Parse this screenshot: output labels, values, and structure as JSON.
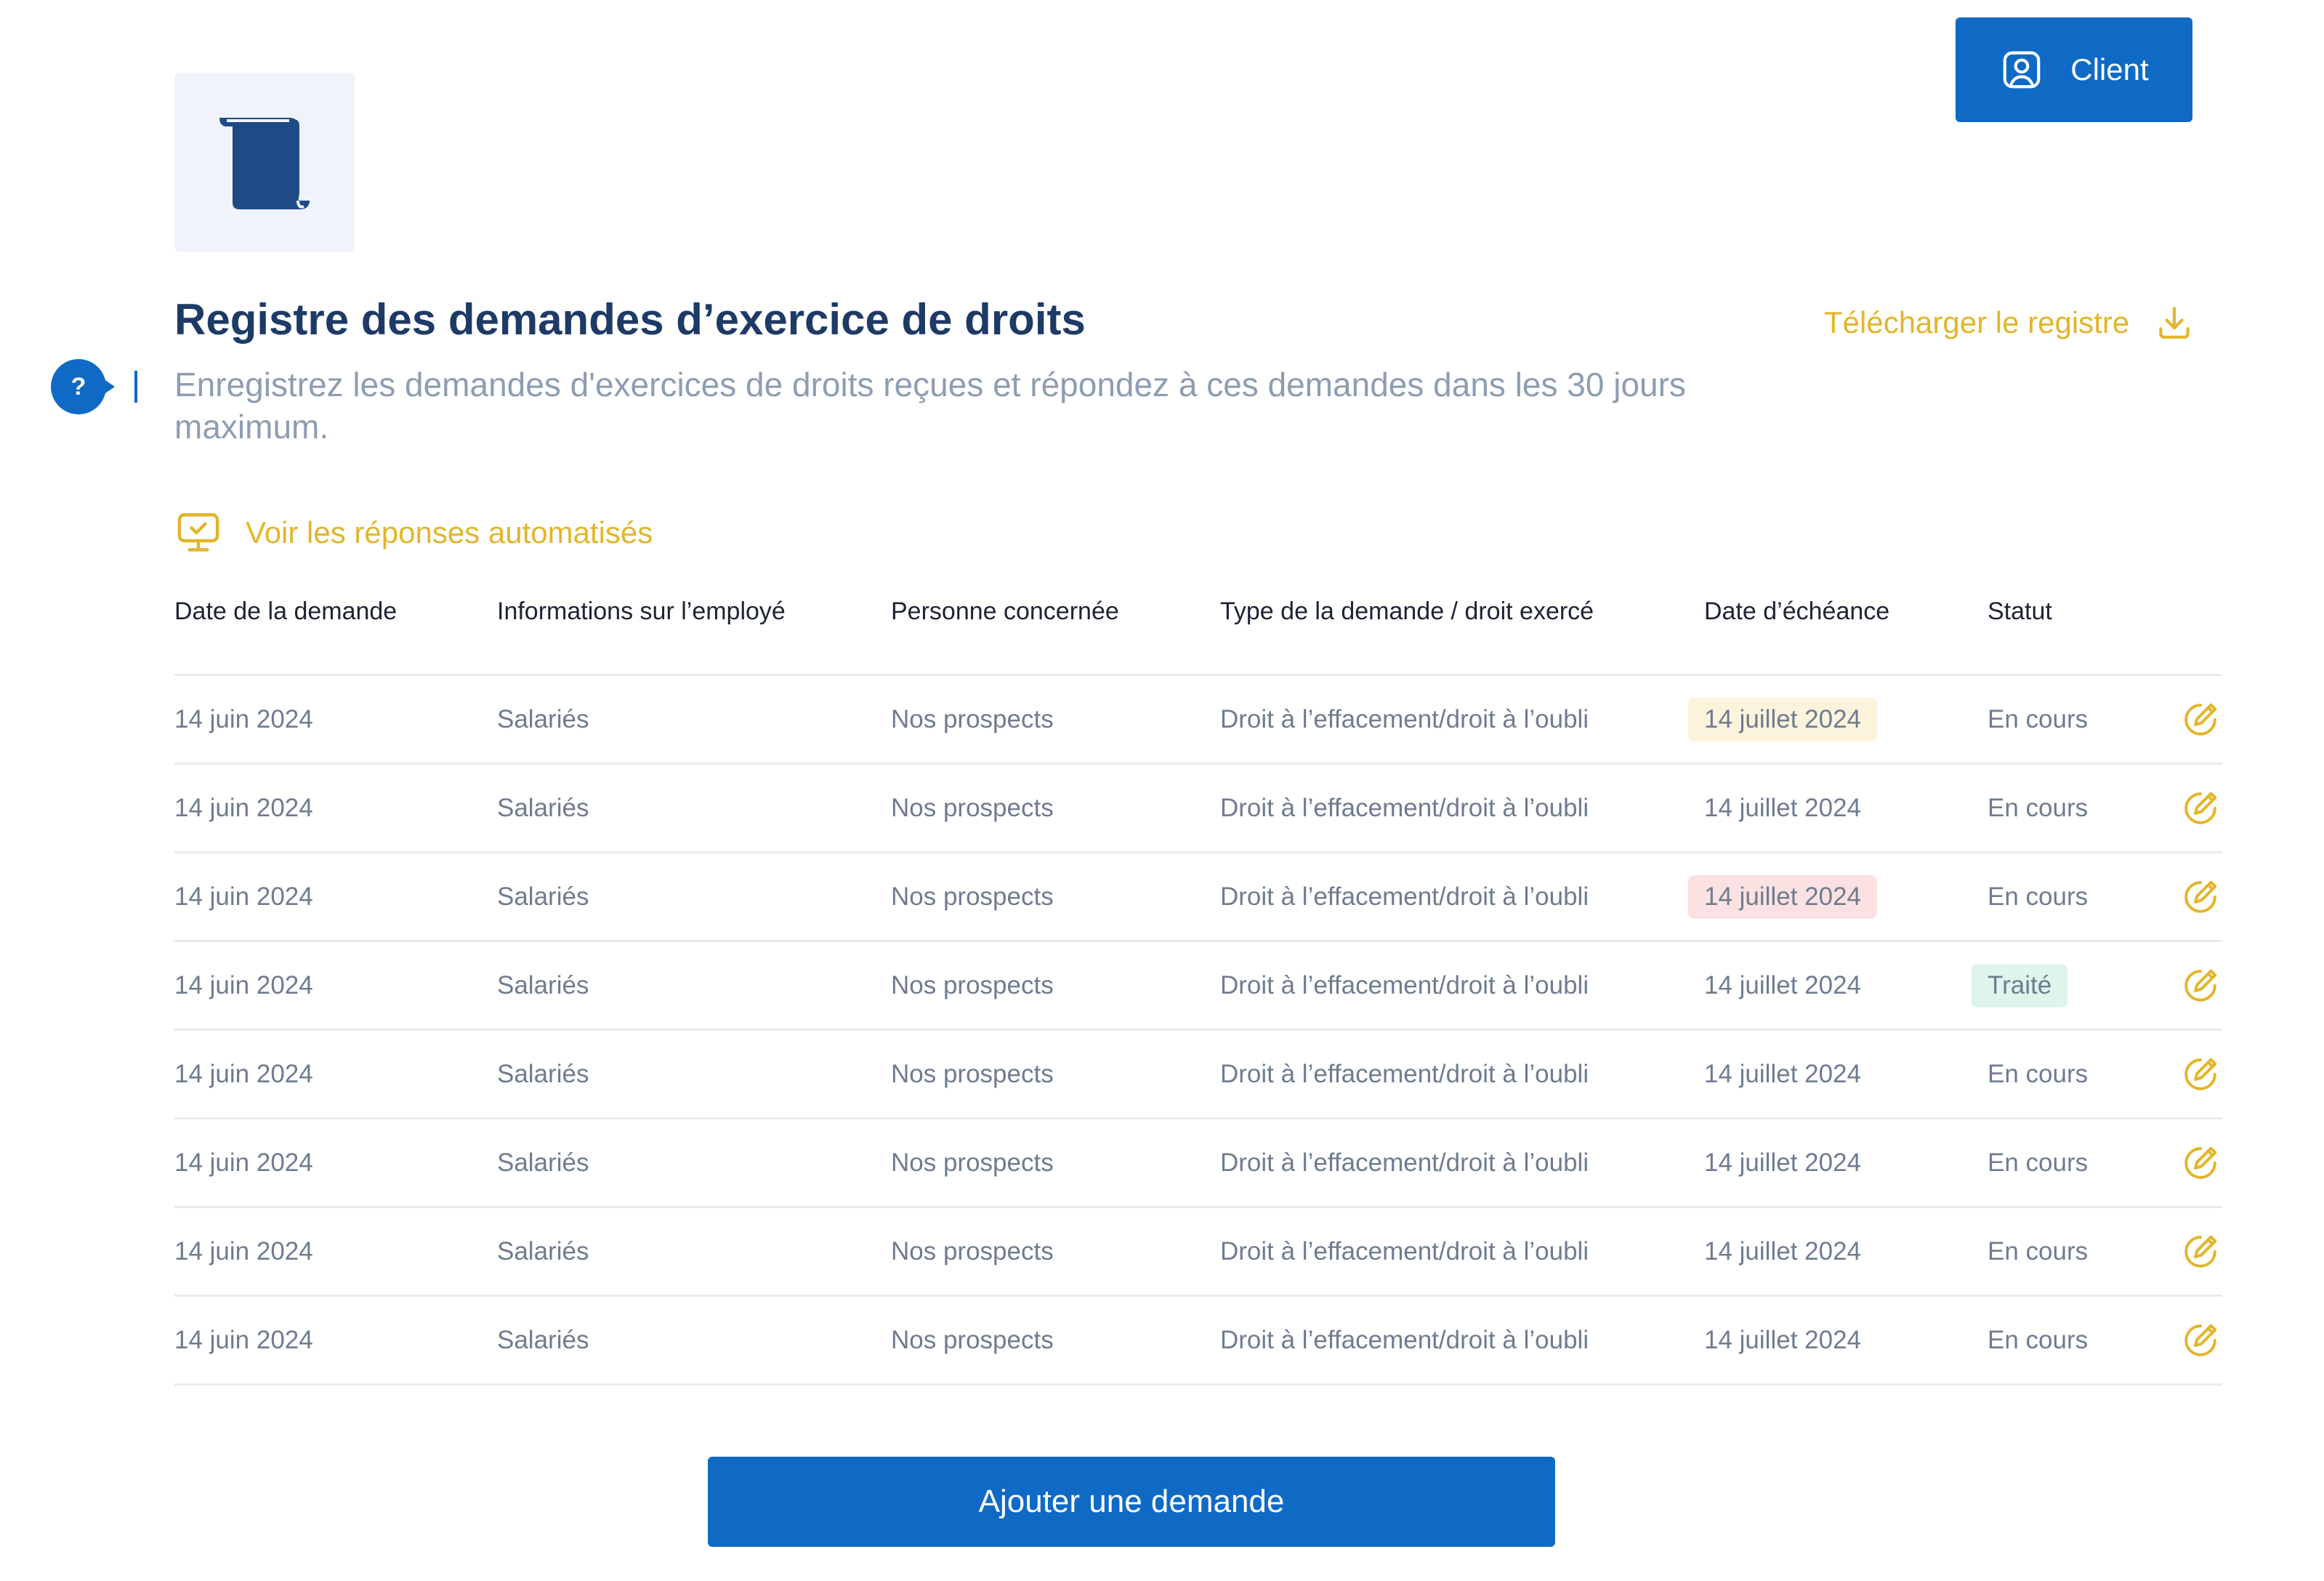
{
  "header": {
    "client_button_label": "Client",
    "title": "Registre des demandes d’exercice de droits",
    "subtitle": "Enregistrez les demandes d'exercices de droits reçues et répondez à ces demandes dans les 30 jours maximum.",
    "download_label": "Télécharger le registre",
    "help_label": "?",
    "auto_responses_label": "Voir les réponses automatisés"
  },
  "table": {
    "columns": [
      "Date de la demande",
      "Informations sur l’employé",
      "Personne concernée",
      "Type de la demande / droit exercé",
      "Date d’échéance",
      "Statut"
    ],
    "rows": [
      {
        "date": "14 juin 2024",
        "employee": "Salariés",
        "person": "Nos prospects",
        "type": "Droit à l’effacement/droit à l’oubli",
        "due": "14 juillet 2024",
        "due_highlight": "yellow",
        "status": "En cours",
        "status_highlight": "none"
      },
      {
        "date": "14 juin 2024",
        "employee": "Salariés",
        "person": "Nos prospects",
        "type": "Droit à l’effacement/droit à l’oubli",
        "due": "14 juillet 2024",
        "due_highlight": "none",
        "status": "En cours",
        "status_highlight": "none"
      },
      {
        "date": "14 juin 2024",
        "employee": "Salariés",
        "person": "Nos prospects",
        "type": "Droit à l’effacement/droit à l’oubli",
        "due": "14 juillet 2024",
        "due_highlight": "red",
        "status": "En cours",
        "status_highlight": "none"
      },
      {
        "date": "14 juin 2024",
        "employee": "Salariés",
        "person": "Nos prospects",
        "type": "Droit à l’effacement/droit à l’oubli",
        "due": "14 juillet 2024",
        "due_highlight": "none",
        "status": "Traité",
        "status_highlight": "green"
      },
      {
        "date": "14 juin 2024",
        "employee": "Salariés",
        "person": "Nos prospects",
        "type": "Droit à l’effacement/droit à l’oubli",
        "due": "14 juillet 2024",
        "due_highlight": "none",
        "status": "En cours",
        "status_highlight": "none"
      },
      {
        "date": "14 juin 2024",
        "employee": "Salariés",
        "person": "Nos prospects",
        "type": "Droit à l’effacement/droit à l’oubli",
        "due": "14 juillet 2024",
        "due_highlight": "none",
        "status": "En cours",
        "status_highlight": "none"
      },
      {
        "date": "14 juin 2024",
        "employee": "Salariés",
        "person": "Nos prospects",
        "type": "Droit à l’effacement/droit à l’oubli",
        "due": "14 juillet 2024",
        "due_highlight": "none",
        "status": "En cours",
        "status_highlight": "none"
      },
      {
        "date": "14 juin 2024",
        "employee": "Salariés",
        "person": "Nos prospects",
        "type": "Droit à l’effacement/droit à l’oubli",
        "due": "14 juillet 2024",
        "due_highlight": "none",
        "status": "En cours",
        "status_highlight": "none"
      }
    ]
  },
  "footer": {
    "add_button_label": "Ajouter une demande"
  },
  "icons": {
    "client": "user-square-icon",
    "logo": "scroll-icon",
    "download": "download-icon",
    "auto_responses": "monitor-check-icon",
    "edit": "edit-icon"
  },
  "colors": {
    "primary": "#0f6ac6",
    "accent": "#e3b52a",
    "title": "#1e3a66",
    "muted_text": "#6e7c91",
    "due_yellow_bg": "#fcf3dc",
    "due_red_bg": "#fbe1e1",
    "status_green_bg": "#dff5ec"
  }
}
